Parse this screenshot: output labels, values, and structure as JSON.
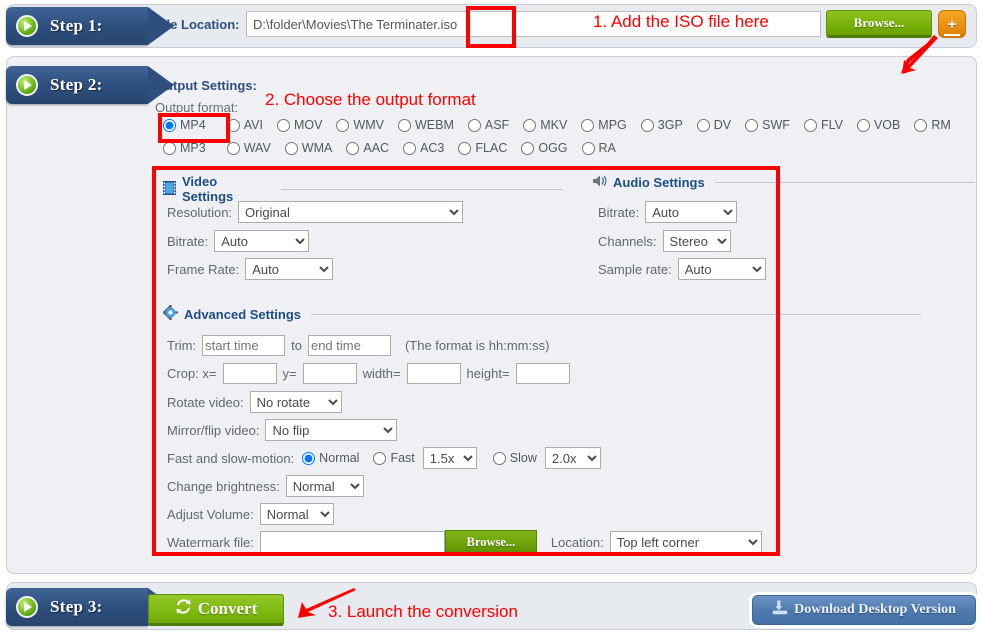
{
  "steps": {
    "step1_label": "Step 1:",
    "step2_label": "Step 2:",
    "step3_label": "Step 3:"
  },
  "step1": {
    "file_location_label": "File Location:",
    "file_path_value": "D:\\folder\\Movies\\The Terminater.iso",
    "file_path_placeholder": "",
    "browse_label": "Browse...",
    "add_more_label": "+"
  },
  "step2": {
    "output_settings_title": "Output Settings:",
    "output_format_label": "Output format:",
    "selected_format": "MP4",
    "video_formats": [
      "MP4",
      "AVI",
      "MOV",
      "WMV",
      "WEBM",
      "ASF",
      "MKV",
      "MPG",
      "3GP",
      "DV",
      "SWF",
      "FLV",
      "VOB",
      "RM"
    ],
    "audio_formats": [
      "MP3",
      "WAV",
      "WMA",
      "AAC",
      "AC3",
      "FLAC",
      "OGG",
      "RA"
    ],
    "video_settings": {
      "title": "Video Settings",
      "resolution_label": "Resolution:",
      "resolution_value": "Original",
      "resolution_options": [
        "Original"
      ],
      "bitrate_label": "Bitrate:",
      "bitrate_value": "Auto",
      "bitrate_options": [
        "Auto"
      ],
      "frame_rate_label": "Frame Rate:",
      "frame_rate_value": "Auto",
      "frame_rate_options": [
        "Auto"
      ]
    },
    "audio_settings": {
      "title": "Audio Settings",
      "bitrate_label": "Bitrate:",
      "bitrate_value": "Auto",
      "bitrate_options": [
        "Auto"
      ],
      "channels_label": "Channels:",
      "channels_value": "Stereo",
      "channels_options": [
        "Stereo"
      ],
      "sample_rate_label": "Sample rate:",
      "sample_rate_value": "Auto",
      "sample_rate_options": [
        "Auto"
      ]
    },
    "advanced_settings": {
      "title": "Advanced Settings",
      "trim_label": "Trim:",
      "trim_start_placeholder": "start time",
      "trim_start_value": "",
      "trim_to_label": "to",
      "trim_end_placeholder": "end time",
      "trim_end_value": "",
      "trim_hint": "(The format is hh:mm:ss)",
      "crop_label": "Crop: x=",
      "crop_x_value": "",
      "crop_y_label": "y=",
      "crop_y_value": "",
      "crop_width_label": "width=",
      "crop_width_value": "",
      "crop_height_label": "height=",
      "crop_height_value": "",
      "rotate_label": "Rotate video:",
      "rotate_value": "No rotate",
      "rotate_options": [
        "No rotate"
      ],
      "mirror_label": "Mirror/flip video:",
      "mirror_value": "No flip",
      "mirror_options": [
        "No flip"
      ],
      "motion_label": "Fast and slow-motion:",
      "motion_normal_label": "Normal",
      "motion_fast_label": "Fast",
      "motion_fast_value": "1.5x",
      "motion_fast_options": [
        "1.5x"
      ],
      "motion_slow_label": "Slow",
      "motion_slow_value": "2.0x",
      "motion_slow_options": [
        "2.0x"
      ],
      "motion_selected": "Normal",
      "brightness_label": "Change brightness:",
      "brightness_value": "Normal",
      "brightness_options": [
        "Normal"
      ],
      "volume_label": "Adjust Volume:",
      "volume_value": "Normal",
      "volume_options": [
        "Normal"
      ],
      "watermark_label": "Watermark file:",
      "watermark_value": "",
      "watermark_placeholder": "",
      "watermark_browse_label": "Browse...",
      "watermark_location_label": "Location:",
      "watermark_location_value": "Top left corner",
      "watermark_location_options": [
        "Top left corner"
      ]
    }
  },
  "step3": {
    "convert_label": "Convert",
    "download_desktop_label": "Download Desktop Version"
  },
  "annotations": {
    "note1": "1. Add the ISO file here",
    "note2": "2. Choose the output format",
    "note3": "3. Launch the conversion",
    "color": "#fd0000"
  }
}
